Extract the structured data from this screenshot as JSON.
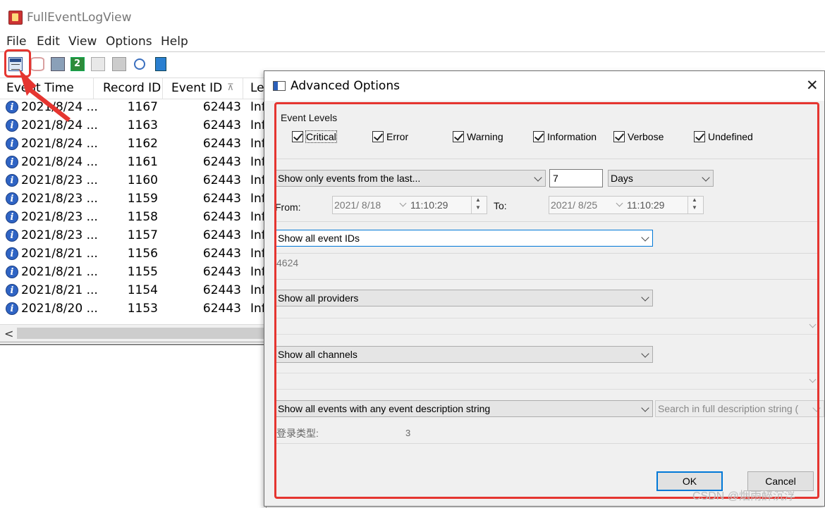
{
  "app": {
    "title": "FullEventLogView"
  },
  "menu": [
    "File",
    "Edit",
    "View",
    "Options",
    "Help"
  ],
  "toolbar": {
    "icons": [
      "advanced-options-icon",
      "database-icon",
      "save-icon",
      "refresh-icon",
      "copy-icon",
      "properties-icon",
      "find-icon",
      "exit-icon"
    ]
  },
  "table": {
    "columns": [
      "Event Time",
      "Record ID",
      "Event ID",
      "Le"
    ],
    "rows": [
      {
        "time": "2021/8/24 ...",
        "record": "1167",
        "event": "62443",
        "level": "Inf"
      },
      {
        "time": "2021/8/24 ...",
        "record": "1163",
        "event": "62443",
        "level": "Inf"
      },
      {
        "time": "2021/8/24 ...",
        "record": "1162",
        "event": "62443",
        "level": "Inf"
      },
      {
        "time": "2021/8/24 ...",
        "record": "1161",
        "event": "62443",
        "level": "Inf"
      },
      {
        "time": "2021/8/23 ...",
        "record": "1160",
        "event": "62443",
        "level": "Inf"
      },
      {
        "time": "2021/8/23 ...",
        "record": "1159",
        "event": "62443",
        "level": "Inf"
      },
      {
        "time": "2021/8/23 ...",
        "record": "1158",
        "event": "62443",
        "level": "Inf"
      },
      {
        "time": "2021/8/23 ...",
        "record": "1157",
        "event": "62443",
        "level": "Inf"
      },
      {
        "time": "2021/8/21 ...",
        "record": "1156",
        "event": "62443",
        "level": "Inf"
      },
      {
        "time": "2021/8/21 ...",
        "record": "1155",
        "event": "62443",
        "level": "Inf"
      },
      {
        "time": "2021/8/21 ...",
        "record": "1154",
        "event": "62443",
        "level": "Inf"
      },
      {
        "time": "2021/8/20 ...",
        "record": "1153",
        "event": "62443",
        "level": "Inf"
      }
    ]
  },
  "dialog": {
    "title": "Advanced Options",
    "event_levels_label": "Event Levels",
    "levels": [
      "Critical",
      "Error",
      "Warning",
      "Information",
      "Verbose",
      "Undefined"
    ],
    "time_filter": {
      "mode": "Show only events from the last...",
      "amount": "7",
      "unit": "Days",
      "from_label": "From:",
      "from_date": "2021/ 8/18",
      "from_time": "11:10:29",
      "to_label": "To:",
      "to_date": "2021/ 8/25",
      "to_time": "11:10:29"
    },
    "event_ids": {
      "mode": "Show all event IDs",
      "value": "4624"
    },
    "providers": {
      "mode": "Show all providers",
      "value": ""
    },
    "channels": {
      "mode": "Show all channels",
      "value": ""
    },
    "description": {
      "mode": "Show all events with any event description string",
      "search_mode": "Search in full description string (",
      "value_label": "登录类型:",
      "value": "3"
    },
    "ok_label": "OK",
    "cancel_label": "Cancel"
  },
  "watermark": "CSDN @烟雨醉沉浮",
  "colors": {
    "highlight": "#e53530",
    "focus": "#0078d7"
  }
}
